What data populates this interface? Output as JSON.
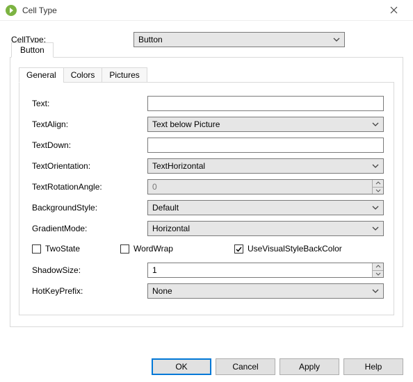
{
  "window": {
    "title": "Cell Type"
  },
  "top": {
    "label": "CellType:",
    "value": "Button"
  },
  "outerTab": "Button",
  "innerTabs": {
    "t0": "General",
    "t1": "Colors",
    "t2": "Pictures"
  },
  "form": {
    "text_label": "Text:",
    "text_value": "",
    "textalign_label": "TextAlign:",
    "textalign_value": "Text below Picture",
    "textdown_label": "TextDown:",
    "textdown_value": "",
    "orientation_label": "TextOrientation:",
    "orientation_value": "TextHorizontal",
    "rotation_label": "TextRotationAngle:",
    "rotation_value": "0",
    "bgstyle_label": "BackgroundStyle:",
    "bgstyle_value": "Default",
    "gradient_label": "GradientMode:",
    "gradient_value": "Horizontal",
    "twostate_label": "TwoState",
    "wordwrap_label": "WordWrap",
    "usevisual_label": "UseVisualStyleBackColor",
    "shadow_label": "ShadowSize:",
    "shadow_value": "1",
    "hotkey_label": "HotKeyPrefix:",
    "hotkey_value": "None"
  },
  "buttons": {
    "ok": "OK",
    "cancel": "Cancel",
    "apply": "Apply",
    "help": "Help"
  }
}
